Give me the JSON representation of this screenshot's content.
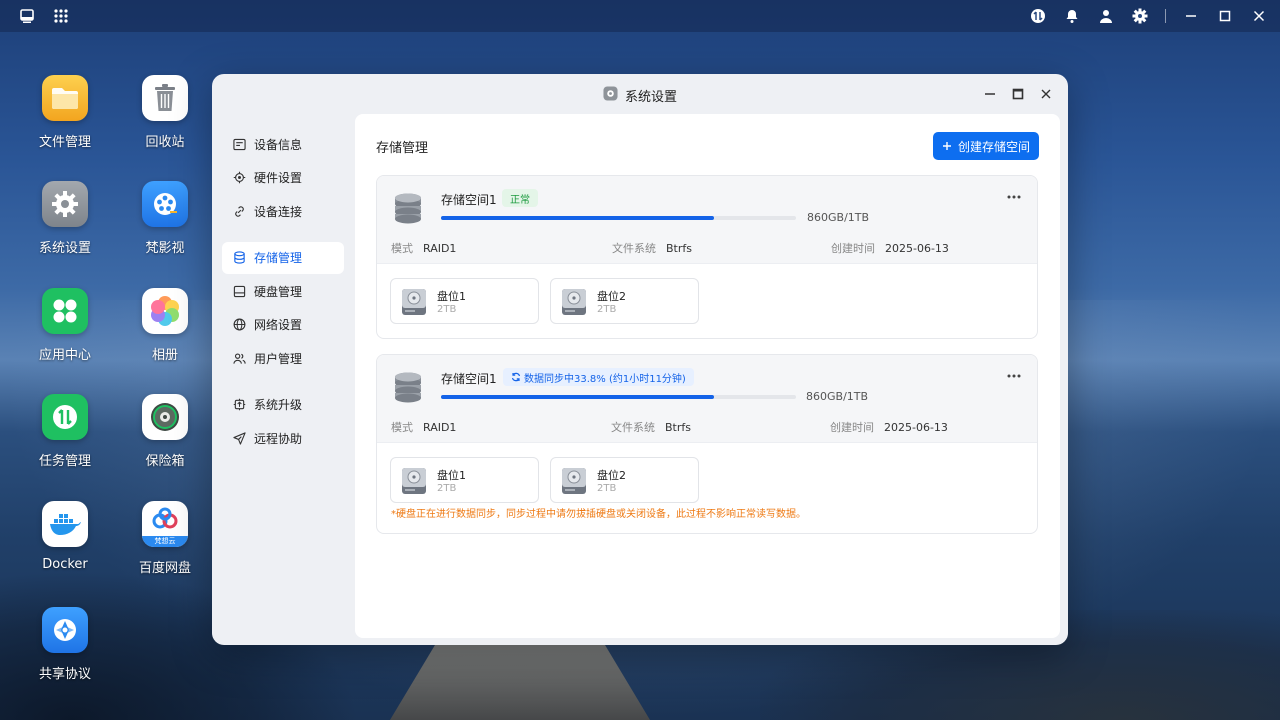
{
  "desktop": {
    "apps": [
      {
        "label": "文件管理",
        "icon": "folder-icon",
        "color": "#f6b52e"
      },
      {
        "label": "回收站",
        "icon": "trash-icon",
        "color": "#ffffff"
      },
      {
        "label": "系统设置",
        "icon": "gear-icon",
        "color": "#8e9399"
      },
      {
        "label": "梵影视",
        "icon": "film-reel-icon",
        "color": "#2b8af0"
      },
      {
        "label": "应用中心",
        "icon": "app-center-icon",
        "color": "#24c265"
      },
      {
        "label": "相册",
        "icon": "photos-flower-icon",
        "color": "#ffffff"
      },
      {
        "label": "任务管理",
        "icon": "task-manager-icon",
        "color": "#24c265"
      },
      {
        "label": "保险箱",
        "icon": "safe-icon",
        "color": "#ffffff"
      },
      {
        "label": "Docker",
        "icon": "docker-whale-icon",
        "color": "#ffffff"
      },
      {
        "label": "百度网盘",
        "icon": "baidu-netdisk-icon",
        "color": "#ffffff"
      },
      {
        "label": "共享协议",
        "icon": "share-protocol-icon",
        "color": "#2b8af0"
      }
    ],
    "baidu_tile_caption": "梵想云"
  },
  "window": {
    "title": "系统设置",
    "nav": [
      {
        "label": "设备信息",
        "icon": "device-info-icon"
      },
      {
        "label": "硬件设置",
        "icon": "hardware-icon"
      },
      {
        "label": "设备连接",
        "icon": "link-icon"
      },
      {
        "label": "存储管理",
        "icon": "database-icon",
        "active": true
      },
      {
        "label": "硬盘管理",
        "icon": "hard-disk-icon"
      },
      {
        "label": "网络设置",
        "icon": "globe-icon"
      },
      {
        "label": "用户管理",
        "icon": "users-icon"
      },
      {
        "label": "系统升级",
        "icon": "upgrade-icon"
      },
      {
        "label": "远程协助",
        "icon": "send-icon"
      }
    ]
  },
  "main": {
    "title": "存储管理",
    "create_button": "创建存储空间",
    "pools": [
      {
        "name": "存储空间1",
        "status": "正常",
        "status_type": "ok",
        "usage_fraction": 0.77,
        "capacity": "860GB/1TB",
        "mode_label": "模式",
        "mode_value": "RAID1",
        "fs_label": "文件系统",
        "fs_value": "Btrfs",
        "created_label": "创建时间",
        "created_value": "2025-06-13",
        "disks": [
          {
            "name": "盘位1",
            "size": "2TB"
          },
          {
            "name": "盘位2",
            "size": "2TB"
          }
        ]
      },
      {
        "name": "存储空间1",
        "status": "数据同步中33.8% (约1小时11分钟)",
        "status_type": "sync",
        "usage_fraction": 0.77,
        "capacity": "860GB/1TB",
        "mode_label": "模式",
        "mode_value": "RAID1",
        "fs_label": "文件系统",
        "fs_value": "Btrfs",
        "created_label": "创建时间",
        "created_value": "2025-06-13",
        "disks": [
          {
            "name": "盘位1",
            "size": "2TB"
          },
          {
            "name": "盘位2",
            "size": "2TB"
          }
        ],
        "warning": "*硬盘正在进行数据同步，同步过程中请勿拔插硬盘或关闭设备，此过程不影响正常读写数据。"
      }
    ]
  },
  "colors": {
    "accent": "#1463e8",
    "ok": "#1b9a3e",
    "warning": "#ee7a14"
  }
}
